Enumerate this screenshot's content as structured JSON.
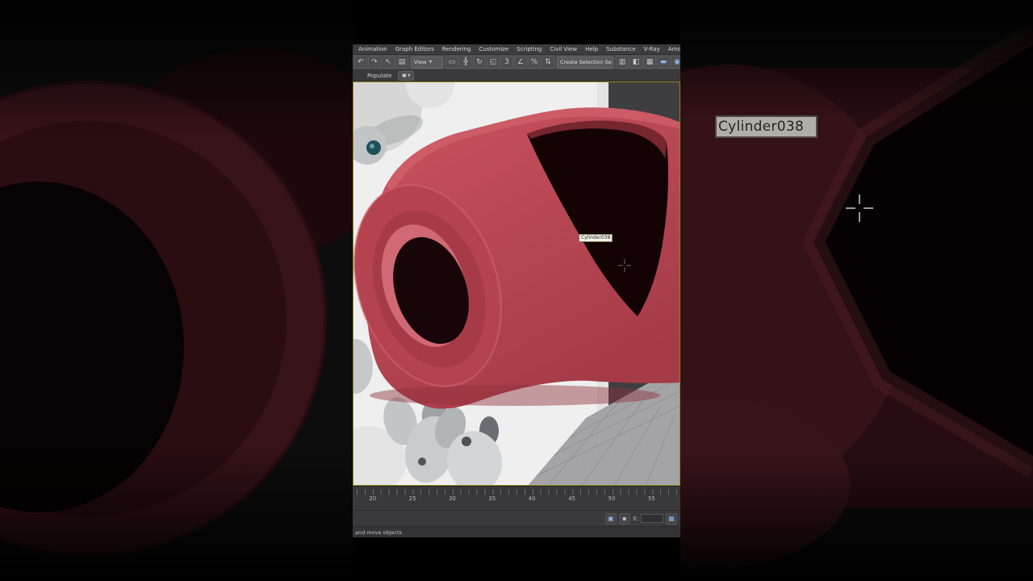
{
  "menu": {
    "items": [
      "Animation",
      "Graph Editors",
      "Rendering",
      "Customize",
      "Scripting",
      "Civil View",
      "Help",
      "Substance",
      "V-Ray",
      "Arnold"
    ]
  },
  "toolbar": {
    "view_dropdown_label": "View",
    "selection_dropdown_label": "Create Selection Se",
    "icons_left": [
      {
        "name": "undo-icon",
        "glyph": "↶"
      },
      {
        "name": "redo-icon",
        "glyph": "↷"
      },
      {
        "name": "select-object-icon",
        "glyph": "↖"
      },
      {
        "name": "select-by-name-icon",
        "glyph": "▤"
      }
    ],
    "icons_mid": [
      {
        "name": "rectangular-selection-region-icon",
        "glyph": "▭"
      },
      {
        "name": "select-and-move-icon",
        "glyph": "╬"
      },
      {
        "name": "select-and-rotate-icon",
        "glyph": "↻"
      },
      {
        "name": "select-and-scale-icon",
        "glyph": "◱"
      },
      {
        "name": "snap-toggle-icon",
        "glyph": "3"
      },
      {
        "name": "angle-snap-icon",
        "glyph": "∠"
      },
      {
        "name": "percent-snap-icon",
        "glyph": "%"
      },
      {
        "name": "spinner-snap-icon",
        "glyph": "⇅"
      }
    ],
    "icons_right": [
      {
        "name": "named-selection-sets-icon",
        "glyph": "▥"
      },
      {
        "name": "mirror-icon",
        "glyph": "◧"
      },
      {
        "name": "layer-manager-icon",
        "glyph": "▦"
      },
      {
        "name": "toggle-ribbon-icon",
        "glyph": "▬",
        "accent": true
      },
      {
        "name": "material-editor-icon",
        "glyph": "◉",
        "accent": true
      }
    ]
  },
  "populate": {
    "label": "Populate"
  },
  "viewport": {
    "tooltip": "Cylinder038"
  },
  "magnifier": {
    "tooltip": "Cylinder038"
  },
  "timeline": {
    "ticks": [
      "20",
      "25",
      "30",
      "35",
      "40",
      "45",
      "50",
      "55"
    ]
  },
  "status": {
    "x_label": "X:",
    "prompt": "and move objects"
  },
  "colors": {
    "object_red": "#bf4a56",
    "opening_black": "#130305",
    "viewport_bg": "#3e3e40",
    "ui_panel": "#4b4b4d",
    "active_viewport_border": "#8f841f"
  }
}
